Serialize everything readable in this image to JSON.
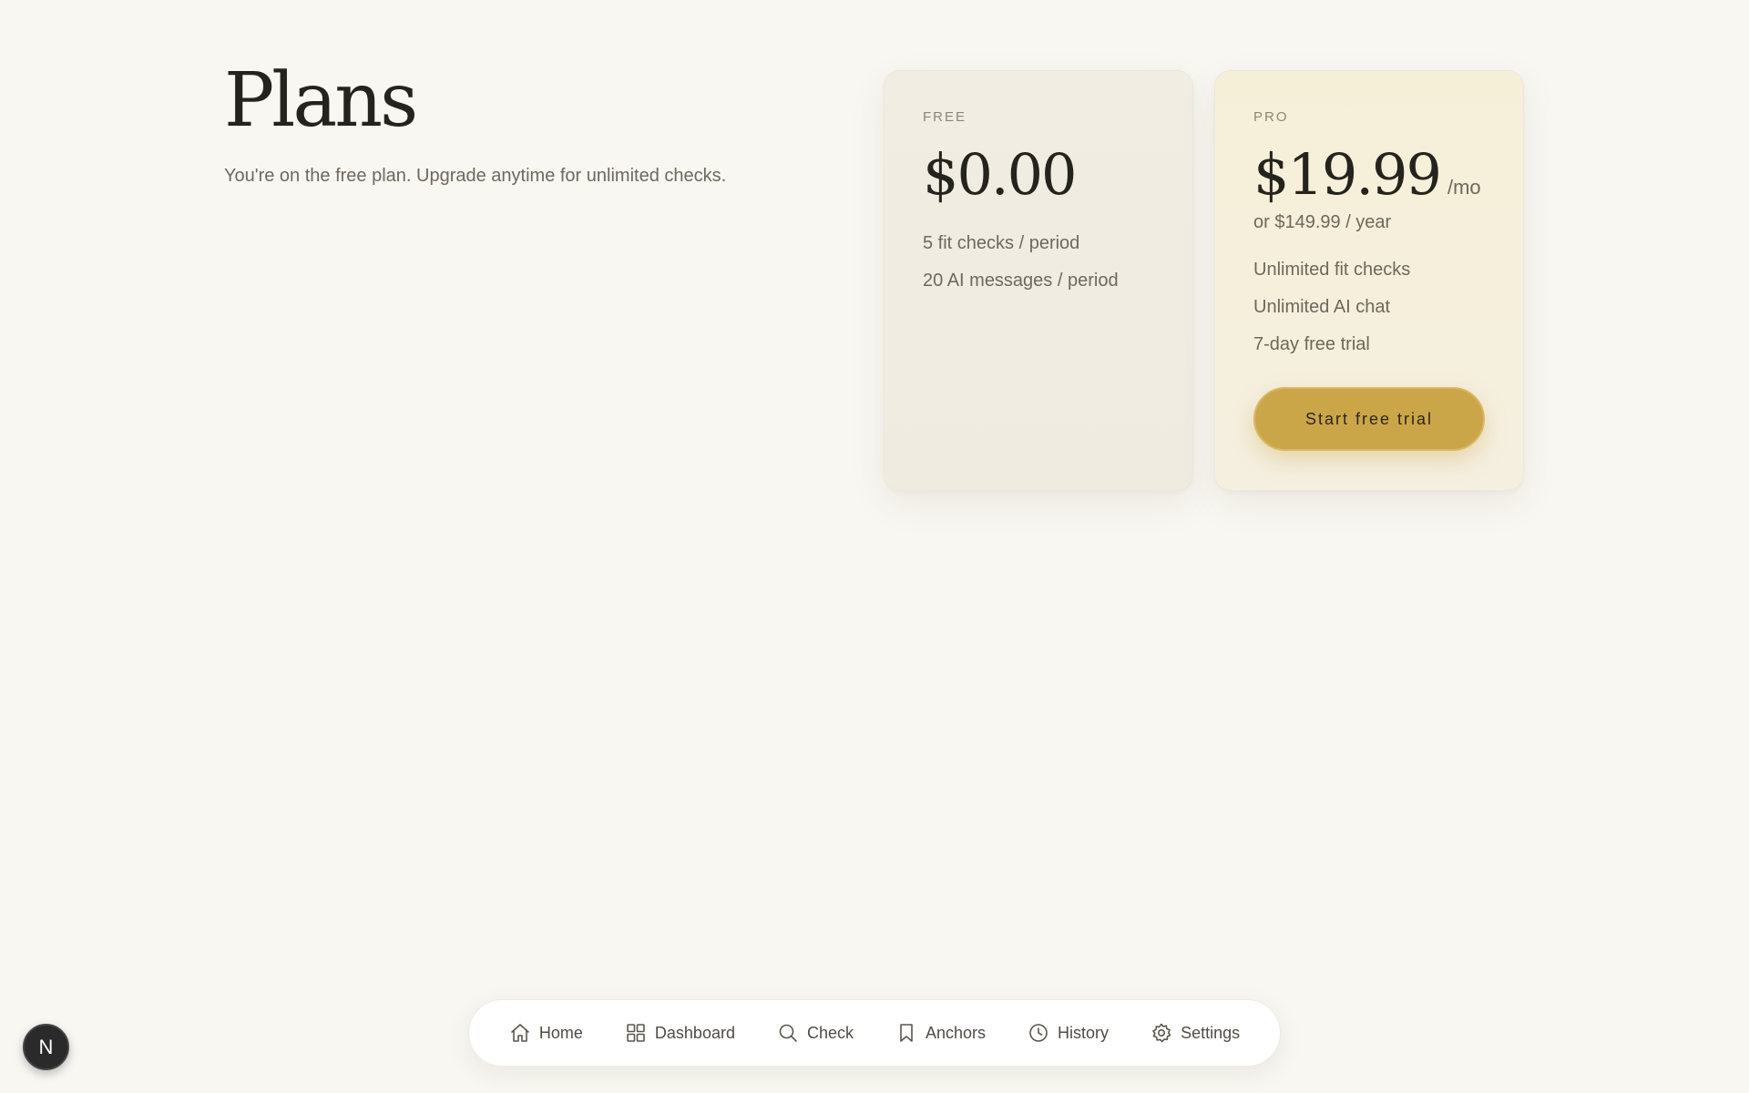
{
  "header": {
    "title": "Plans",
    "subtitle": "You're on the free plan. Upgrade anytime for unlimited checks."
  },
  "plans": {
    "free": {
      "tier": "FREE",
      "price": "$0.00",
      "features": [
        "5 fit checks / period",
        "20 AI messages / period"
      ]
    },
    "pro": {
      "tier": "PRO",
      "price": "$19.99",
      "per": "/mo",
      "alt_price": "or $149.99 / year",
      "features": [
        "Unlimited fit checks",
        "Unlimited AI chat",
        "7-day free trial"
      ],
      "cta_label": "Start free trial",
      "accent_color": "#cba649"
    }
  },
  "nav": {
    "items": [
      {
        "label": "Home",
        "icon": "home-icon"
      },
      {
        "label": "Dashboard",
        "icon": "grid-icon"
      },
      {
        "label": "Check",
        "icon": "search-icon"
      },
      {
        "label": "Anchors",
        "icon": "bookmark-icon"
      },
      {
        "label": "History",
        "icon": "clock-icon"
      },
      {
        "label": "Settings",
        "icon": "gear-icon"
      }
    ]
  },
  "badge": {
    "letter": "N"
  }
}
